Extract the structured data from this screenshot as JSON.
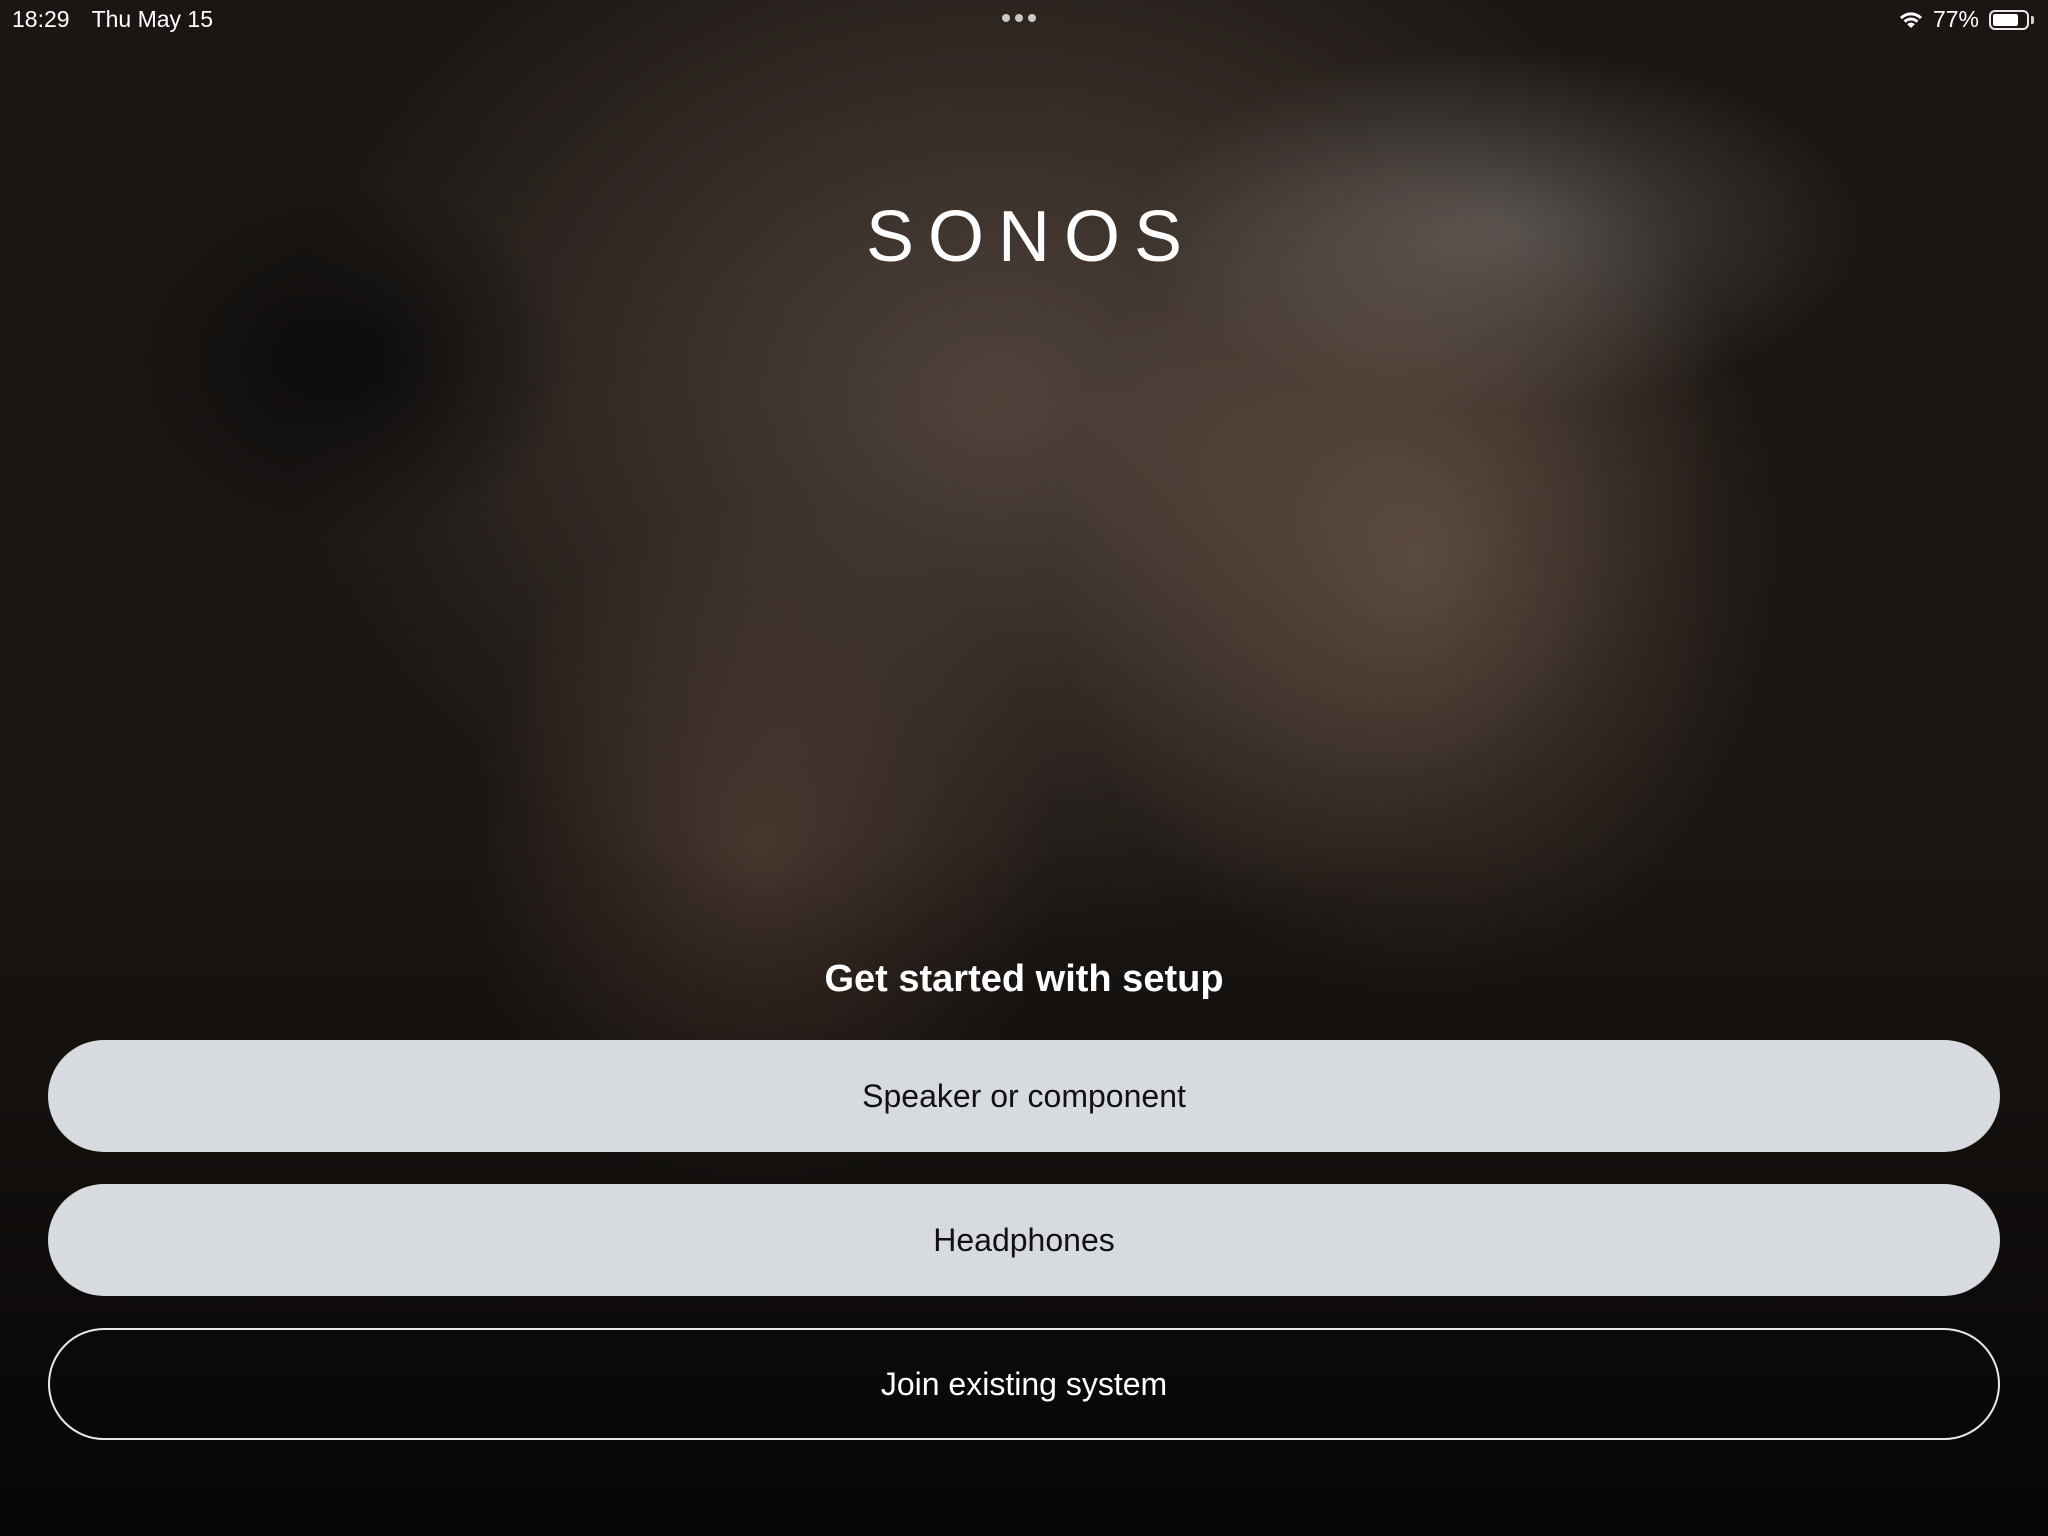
{
  "status_bar": {
    "time": "18:29",
    "date": "Thu May 15",
    "battery_percent_label": "77%",
    "battery_level": 0.77
  },
  "brand": {
    "logo_text": "SONOS"
  },
  "setup": {
    "title": "Get started with setup",
    "buttons": [
      {
        "label": "Speaker or component",
        "style": "filled"
      },
      {
        "label": "Headphones",
        "style": "filled"
      },
      {
        "label": "Join existing system",
        "style": "outline"
      }
    ]
  },
  "colors": {
    "filled_button_bg": "#d7dbe0",
    "filled_button_text": "#111111",
    "outline_button_border": "#e8e8e8",
    "text_light": "#ffffff"
  }
}
